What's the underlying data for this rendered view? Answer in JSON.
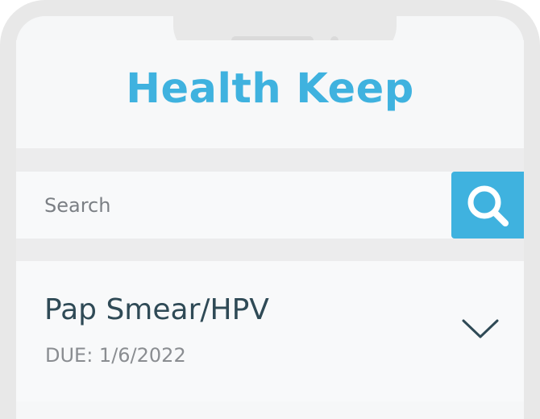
{
  "app": {
    "title": "Health Keep",
    "accent_color": "#3fb2df"
  },
  "search": {
    "placeholder": "Search",
    "value": "",
    "button_icon": "search-icon"
  },
  "items": [
    {
      "title": "Pap Smear/HPV",
      "due": "DUE: 1/6/2022",
      "expand_icon": "chevron-down-icon"
    }
  ]
}
